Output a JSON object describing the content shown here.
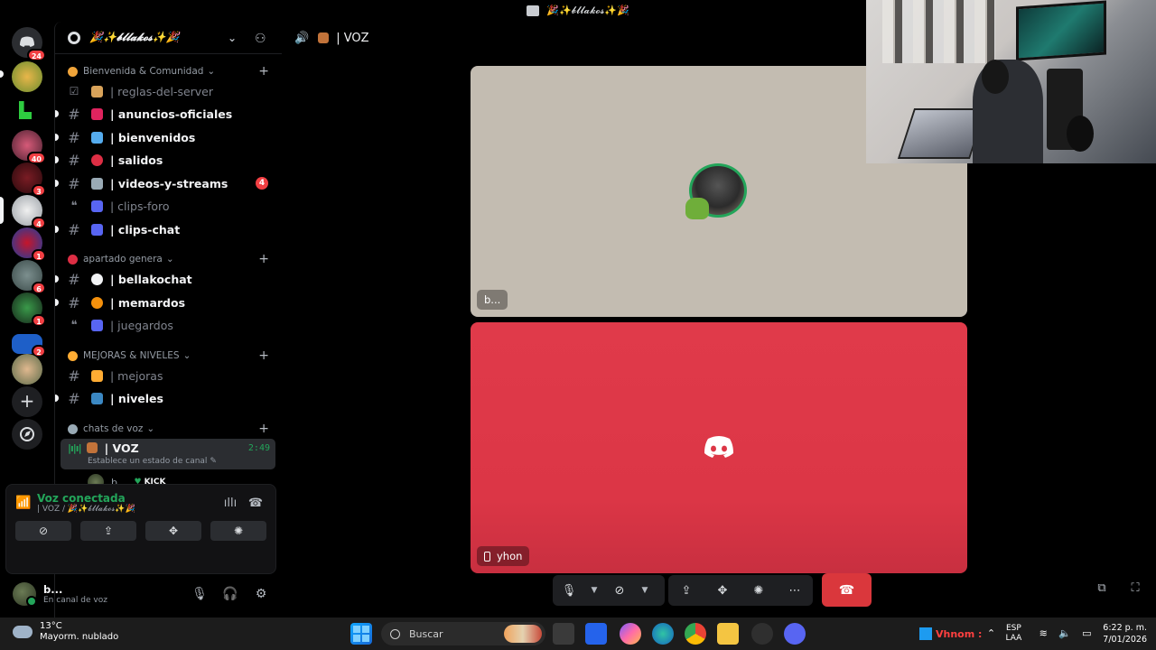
{
  "titlebar": {
    "title": "🎉✨𝓫𝓵𝓵𝓪𝓴𝓸𝓼✨🎉"
  },
  "rail": {
    "badges": [
      "24",
      "40",
      "3",
      "4",
      "1",
      "6",
      "1",
      "2"
    ]
  },
  "server": {
    "name": "🎉✨𝓫𝓵𝓵𝓪𝓴𝓸𝓼✨🎉"
  },
  "categories": [
    {
      "label": "Bienvenida & Comunidad"
    },
    {
      "label": "apartado genera"
    },
    {
      "label": "MEJORAS & NIVELES"
    },
    {
      "label": "chats de voz"
    }
  ],
  "channels": [
    {
      "name": "| reglas-del-server",
      "state": "dim"
    },
    {
      "name": "| anuncios-oficiales",
      "state": "bold"
    },
    {
      "name": "| bienvenidos",
      "state": "bold"
    },
    {
      "name": "| salidos",
      "state": "bold"
    },
    {
      "name": "| videos-y-streams",
      "state": "bold",
      "badge": "4"
    },
    {
      "name": "| clips-foro",
      "state": "dim"
    },
    {
      "name": "| clips-chat",
      "state": "bold"
    },
    {
      "name": "| bellakochat",
      "state": "bold"
    },
    {
      "name": "| memardos",
      "state": "bold"
    },
    {
      "name": "| juegardos",
      "state": "dim"
    },
    {
      "name": "| mejoras",
      "state": "dim"
    },
    {
      "name": "| niveles",
      "state": "bold"
    }
  ],
  "voice_channel": {
    "name": "| VOZ",
    "timer": "2:49",
    "status_prompt": "Establece un estado de canal",
    "members": [
      {
        "name": "b...",
        "tag": "KICK"
      },
      {
        "name": "yhon"
      }
    ]
  },
  "voice_panel": {
    "title": "Voz conectada",
    "subtitle": "| VOZ / 🎉✨𝓫𝓵𝓵𝓪𝓴𝓸𝓼✨🎉"
  },
  "user_panel": {
    "name": "b...",
    "status": "En canal de voz"
  },
  "main_header": {
    "channel": "| VOZ"
  },
  "tiles": [
    {
      "name": "b..."
    },
    {
      "name": "yhon"
    }
  ],
  "taskbar": {
    "weather_temp": "13°C",
    "weather_desc": "Mayorm. nublado",
    "search_placeholder": "Buscar",
    "tray_user": "Vhnom :",
    "lang_top": "ESP",
    "lang_bottom": "LAA",
    "time": "6:22 p. m.",
    "date": "7/01/2026"
  },
  "colors": {
    "accent_green": "#23a55a",
    "danger_red": "#da373c",
    "tile_red": "#dc3646",
    "tile_beige": "#c3bcb1"
  }
}
